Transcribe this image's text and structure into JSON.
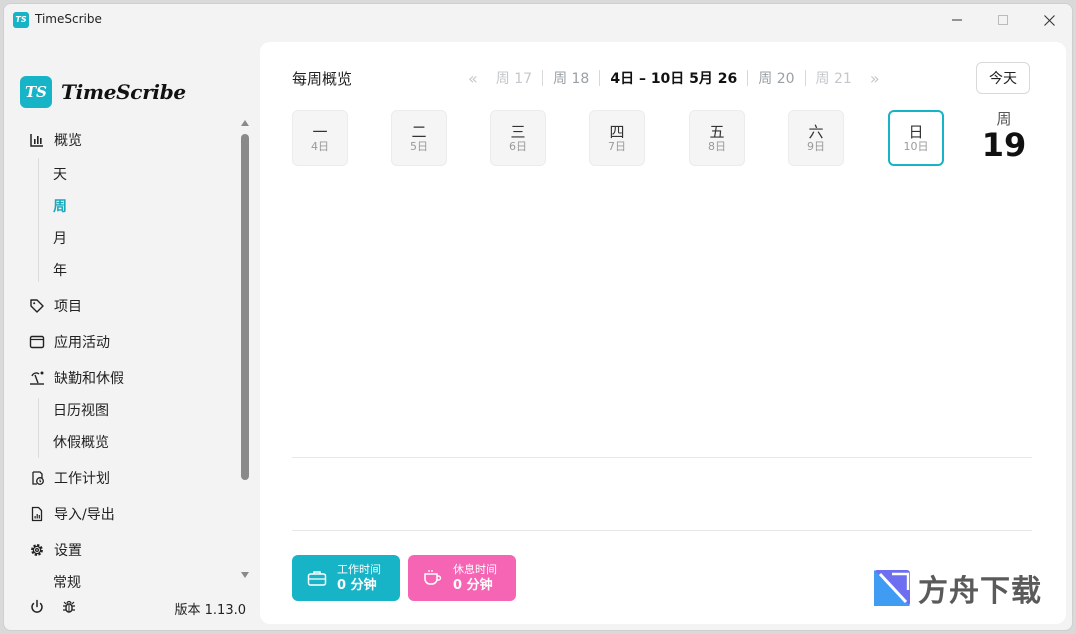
{
  "window": {
    "title": "TimeScribe",
    "app_icon_text": "TS"
  },
  "sidebar": {
    "logo_mark": "TS",
    "logo_text": "TimeScribe",
    "nav": [
      {
        "label": "概览",
        "icon": "bar-chart-icon"
      },
      {
        "label": "项目",
        "icon": "tag-icon"
      },
      {
        "label": "应用活动",
        "icon": "window-icon"
      },
      {
        "label": "缺勤和休假",
        "icon": "beach-icon"
      },
      {
        "label": "工作计划",
        "icon": "clipboard-clock-icon"
      },
      {
        "label": "导入/导出",
        "icon": "file-chart-icon"
      },
      {
        "label": "设置",
        "icon": "gear-icon"
      }
    ],
    "overview_sub": [
      "天",
      "周",
      "月",
      "年"
    ],
    "absence_sub": [
      "日历视图",
      "休假概览"
    ],
    "settings_sub_partial": "常规",
    "active_sub": "周",
    "version": "版本 1.13.0"
  },
  "main": {
    "title": "每周概览",
    "week_nav": {
      "prev_arrow": "«",
      "items": [
        "周 17",
        "周 18",
        "4日 – 10日 5月 26",
        "周 20",
        "周 21"
      ],
      "next_arrow": "»"
    },
    "today_button": "今天",
    "days": [
      {
        "name": "一",
        "date": "4日"
      },
      {
        "name": "二",
        "date": "5日"
      },
      {
        "name": "三",
        "date": "6日"
      },
      {
        "name": "四",
        "date": "7日"
      },
      {
        "name": "五",
        "date": "8日"
      },
      {
        "name": "六",
        "date": "9日"
      },
      {
        "name": "日",
        "date": "10日"
      }
    ],
    "active_day": "日",
    "week_label": "周",
    "week_number": "19",
    "work": {
      "label": "工作时间",
      "value": "0 分钟"
    },
    "break": {
      "label": "休息时间",
      "value": "0 分钟"
    }
  },
  "watermark": {
    "text": "方舟下载"
  },
  "colors": {
    "accent": "#17b3c6",
    "break": "#f565b4"
  }
}
